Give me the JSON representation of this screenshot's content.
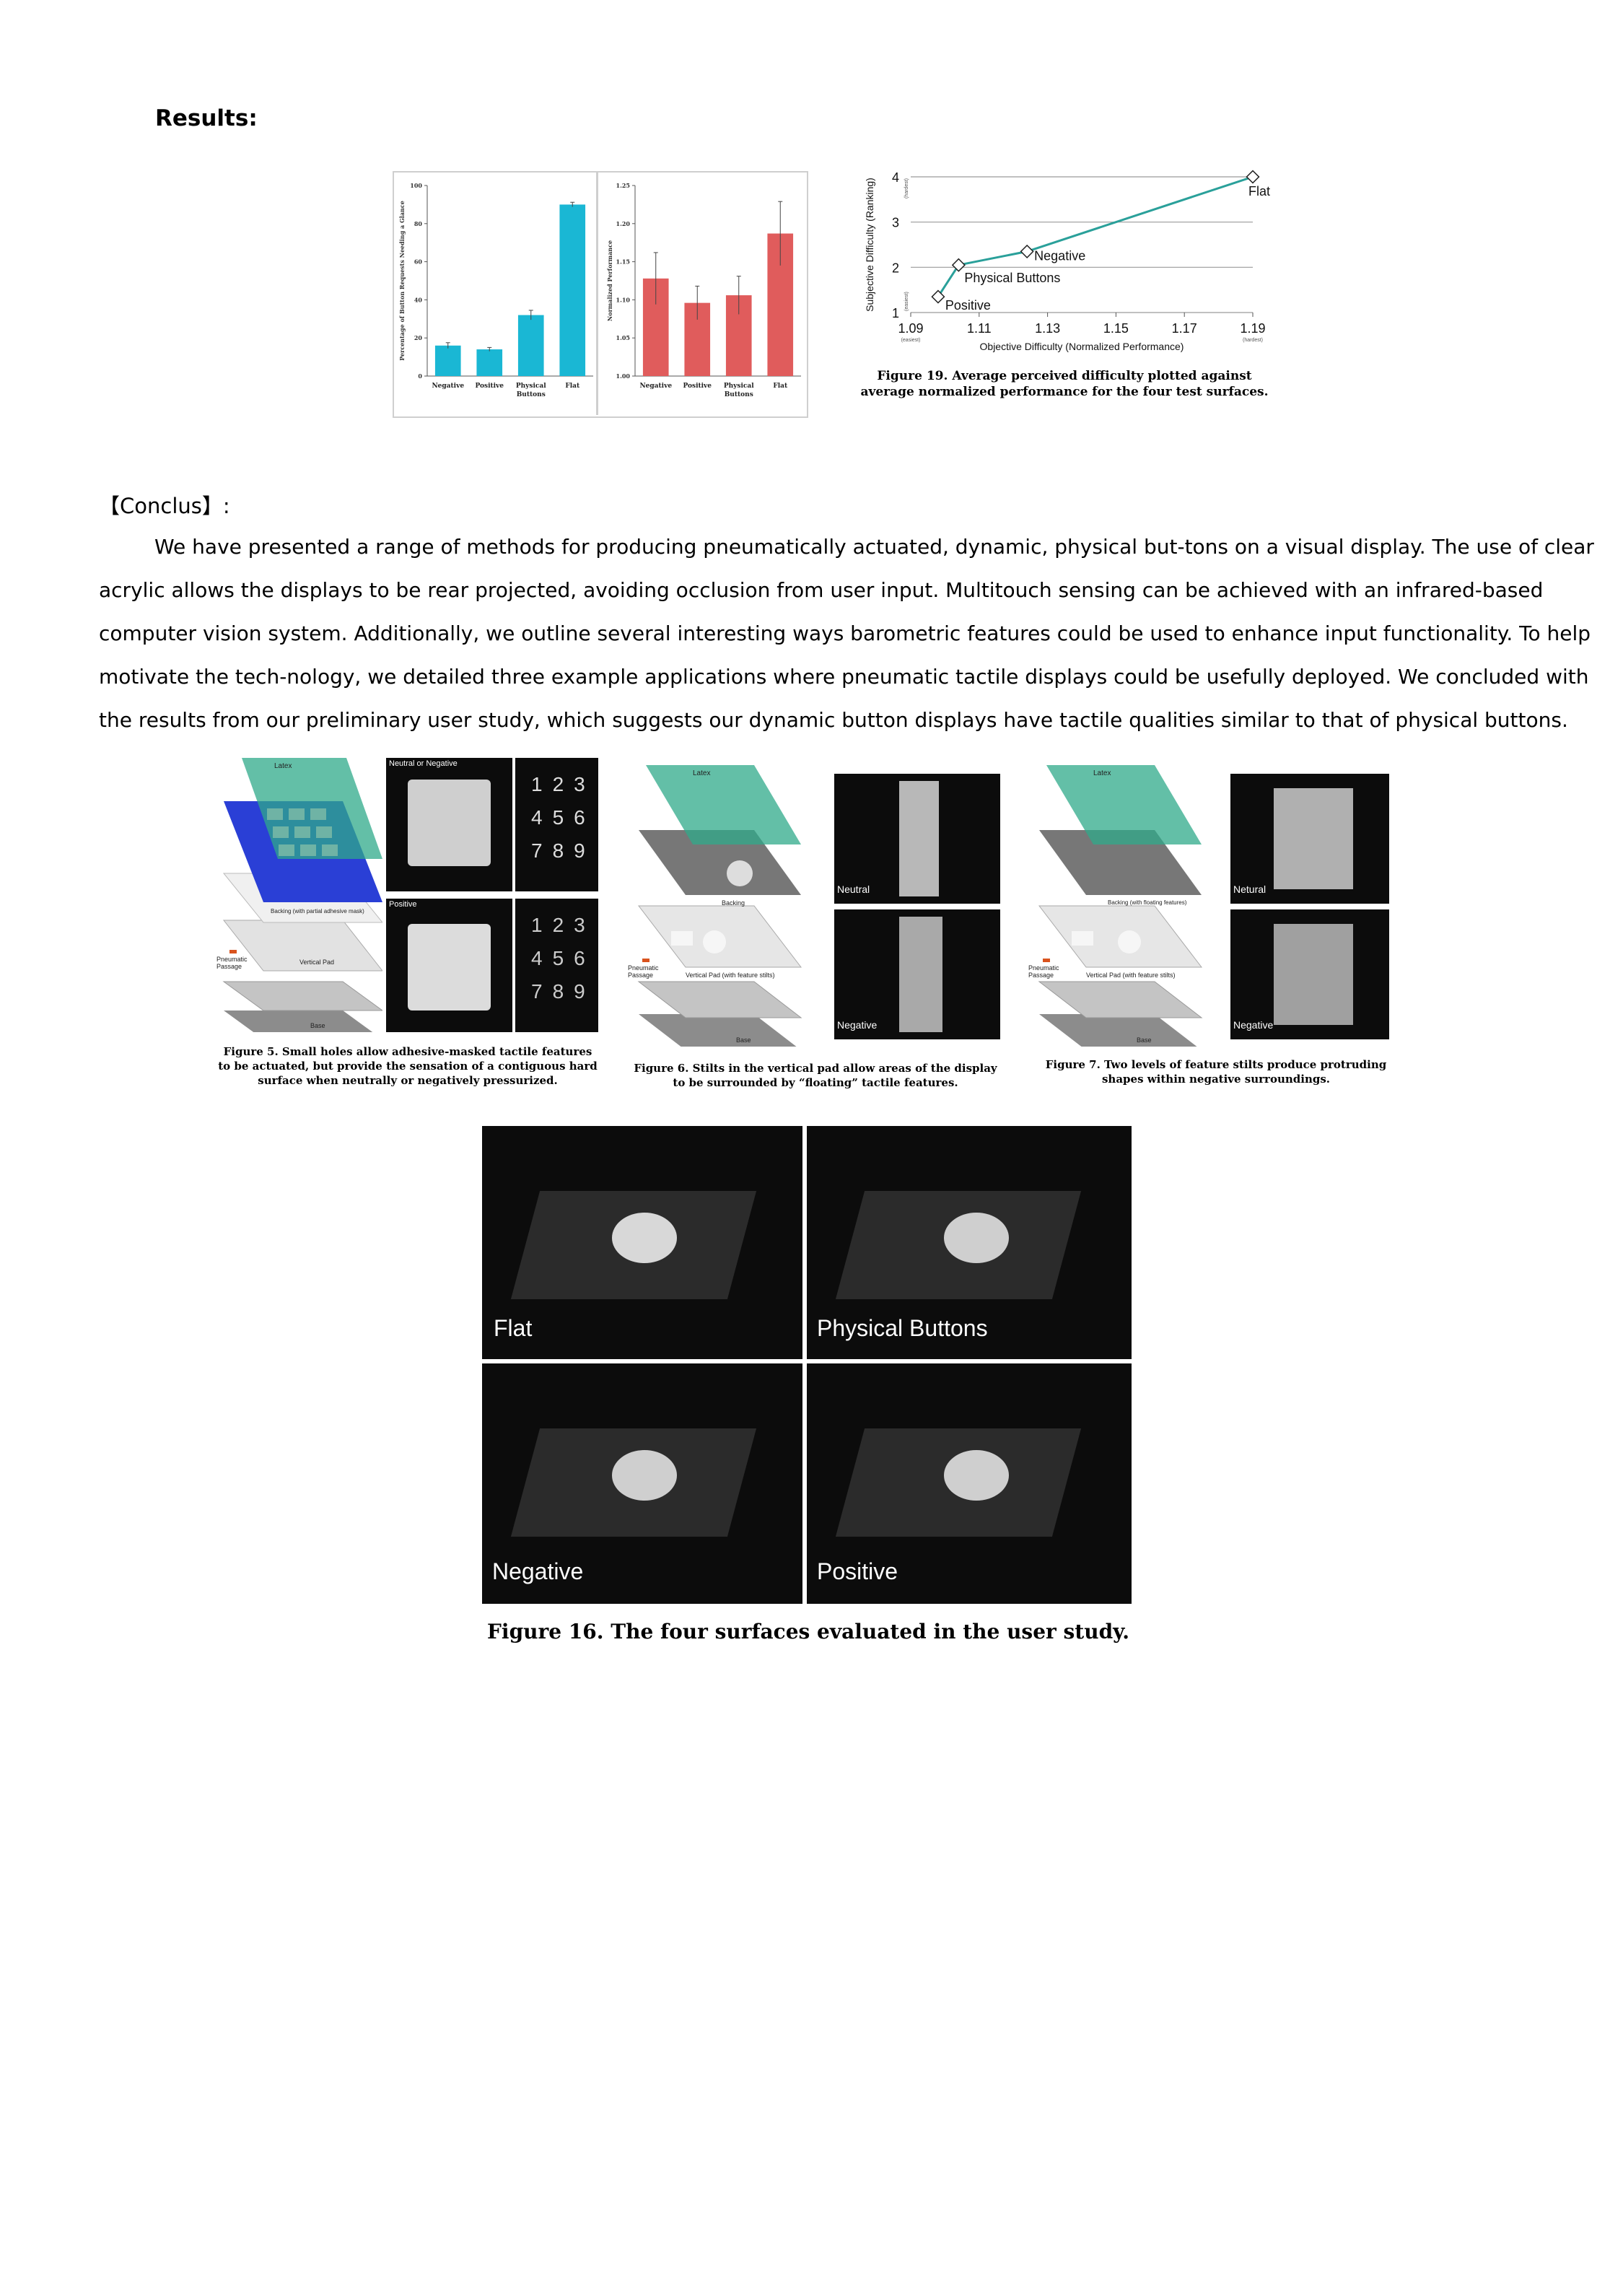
{
  "results_heading": "Results:",
  "conclus_heading": "【Conclus】:",
  "paragraph_lines": [
    "We have presented a range of methods for producing pneumatically actuated, dynamic, physical but-tons on a visual display. The use of clear",
    "acrylic allows the displays to be rear projected, avoiding occlusion from user input. Multitouch sensing can be achieved with an infrared-based",
    "computer vision system. Additionally, we outline several interesting ways barometric features could be used to enhance input functionality. To help",
    "motivate the tech-nology, we detailed three example applications where pneumatic tactile displays could be usefully deployed. We concluded with",
    "the results from our preliminary user study, which suggests our dynamic button displays have tactile qualities similar to that of physical buttons."
  ],
  "chart_data": [
    {
      "type": "bar",
      "categories": [
        "Negative",
        "Positive",
        "Physical Buttons",
        "Flat"
      ],
      "values": [
        16,
        14,
        32,
        90
      ],
      "errors": [
        1.5,
        1.0,
        2.5,
        1.2
      ],
      "ylabel": "Percentage of Button Requests Needing a Glance",
      "ylim": [
        0,
        100
      ],
      "yticks": [
        "0",
        "20",
        "40",
        "60",
        "80",
        "100"
      ],
      "color": "#1ab7d4"
    },
    {
      "type": "bar",
      "categories": [
        "Negative",
        "Positive",
        "Physical Buttons",
        "Flat"
      ],
      "values": [
        1.128,
        1.096,
        1.106,
        1.187
      ],
      "errors": [
        0.034,
        0.022,
        0.025,
        0.042
      ],
      "ylabel": "Normalized Performance",
      "ylim": [
        1.0,
        1.25
      ],
      "yticks": [
        "1.00",
        "1.05",
        "1.10",
        "1.15",
        "1.20",
        "1.25"
      ],
      "color": "#e05c5c"
    },
    {
      "type": "line",
      "points": [
        {
          "name": "Positive",
          "x": 1.098,
          "y": 1.35
        },
        {
          "name": "Physical Buttons",
          "x": 1.104,
          "y": 2.05
        },
        {
          "name": "Negative",
          "x": 1.124,
          "y": 2.35
        },
        {
          "name": "Flat",
          "x": 1.19,
          "y": 4.0
        }
      ],
      "xlabel": "Objective Difficulty (Normalized Performance)",
      "ylabel": "Subjective Difficulty (Ranking)",
      "xticks": [
        "1.09",
        "1.11",
        "1.13",
        "1.15",
        "1.17",
        "1.19"
      ],
      "yticks": [
        "1",
        "2",
        "3",
        "4"
      ],
      "x_easiest": "(easiest)",
      "x_hardest": "(hardest)",
      "y_easiest": "(easiest)",
      "y_hardest": "(hardest)",
      "xlim": [
        1.09,
        1.19
      ],
      "ylim": [
        1,
        4
      ],
      "color": "#2aa09a"
    }
  ],
  "figure19_caption": "Figure 19. Average perceived difficulty plotted against average normalized performance for the four test surfaces.",
  "figure5": {
    "caption": "Figure 5. Small holes allow adhesive-masked tactile features to be actuated, but provide the sensation of a contiguous hard surface when neutrally or negatively pressurized.",
    "labels": [
      "Latex",
      "Backing (with partial adhesive mask)",
      "Pneumatic Passage",
      "Vertical Pad",
      "Base"
    ],
    "photo_labels": [
      "Neutral or Negative",
      "Positive"
    ],
    "keypad_digits": [
      "1",
      "2",
      "3",
      "4",
      "5",
      "6",
      "7",
      "8",
      "9"
    ]
  },
  "figure6": {
    "caption": "Figure 6. Stilts in the vertical pad allow areas of the display to be surrounded by “floating” tactile features.",
    "labels": [
      "Latex",
      "Backing",
      "Pneumatic Passage",
      "Vertical Pad (with feature stilts)",
      "Base"
    ],
    "photo_labels": [
      "Neutral",
      "Negative"
    ]
  },
  "figure7": {
    "caption": "Figure 7. Two levels of feature stilts produce protruding shapes within negative surroundings.",
    "labels": [
      "Latex",
      "Backing (with floating features)",
      "Pneumatic Passage",
      "Vertical Pad (with feature stilts)",
      "Base"
    ],
    "photo_labels": [
      "Netural",
      "Negative"
    ]
  },
  "figure16": {
    "labels": [
      "Flat",
      "Physical Buttons",
      "Negative",
      "Positive"
    ],
    "caption": "Figure 16. The four surfaces evaluated in the user study."
  }
}
